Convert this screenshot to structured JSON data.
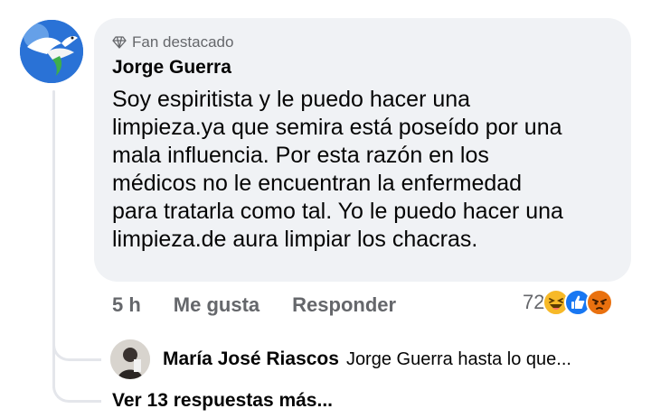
{
  "comment": {
    "badge": "Fan destacado",
    "author": "Jorge Guerra",
    "lines": [
      "Soy espiritista y le puedo hacer una",
      "limpieza.ya que semira está poseído por una",
      "mala influencia. Por esta razón en los",
      "médicos no le encuentran la enfermedad",
      "para tratarla como tal. Yo le puedo hacer una",
      "limpieza.de aura limpiar los chacras."
    ],
    "time": "5 h",
    "like_label": "Me gusta",
    "reply_label": "Responder",
    "reaction_count": "72",
    "reaction_icons": [
      "haha-icon",
      "like-icon",
      "angry-icon"
    ],
    "avatar_icon": "dove-icon"
  },
  "reply": {
    "author": "María José Riascos",
    "snippet": "Jorge Guerra hasta lo que..."
  },
  "more_replies": "Ver 13 respuestas más...",
  "colors": {
    "bubble": "#f0f2f5",
    "secondary_text": "#65676b",
    "like_blue": "#1877f2",
    "haha_yellow": "#f7b928",
    "angry_orange": "#e9710f"
  }
}
